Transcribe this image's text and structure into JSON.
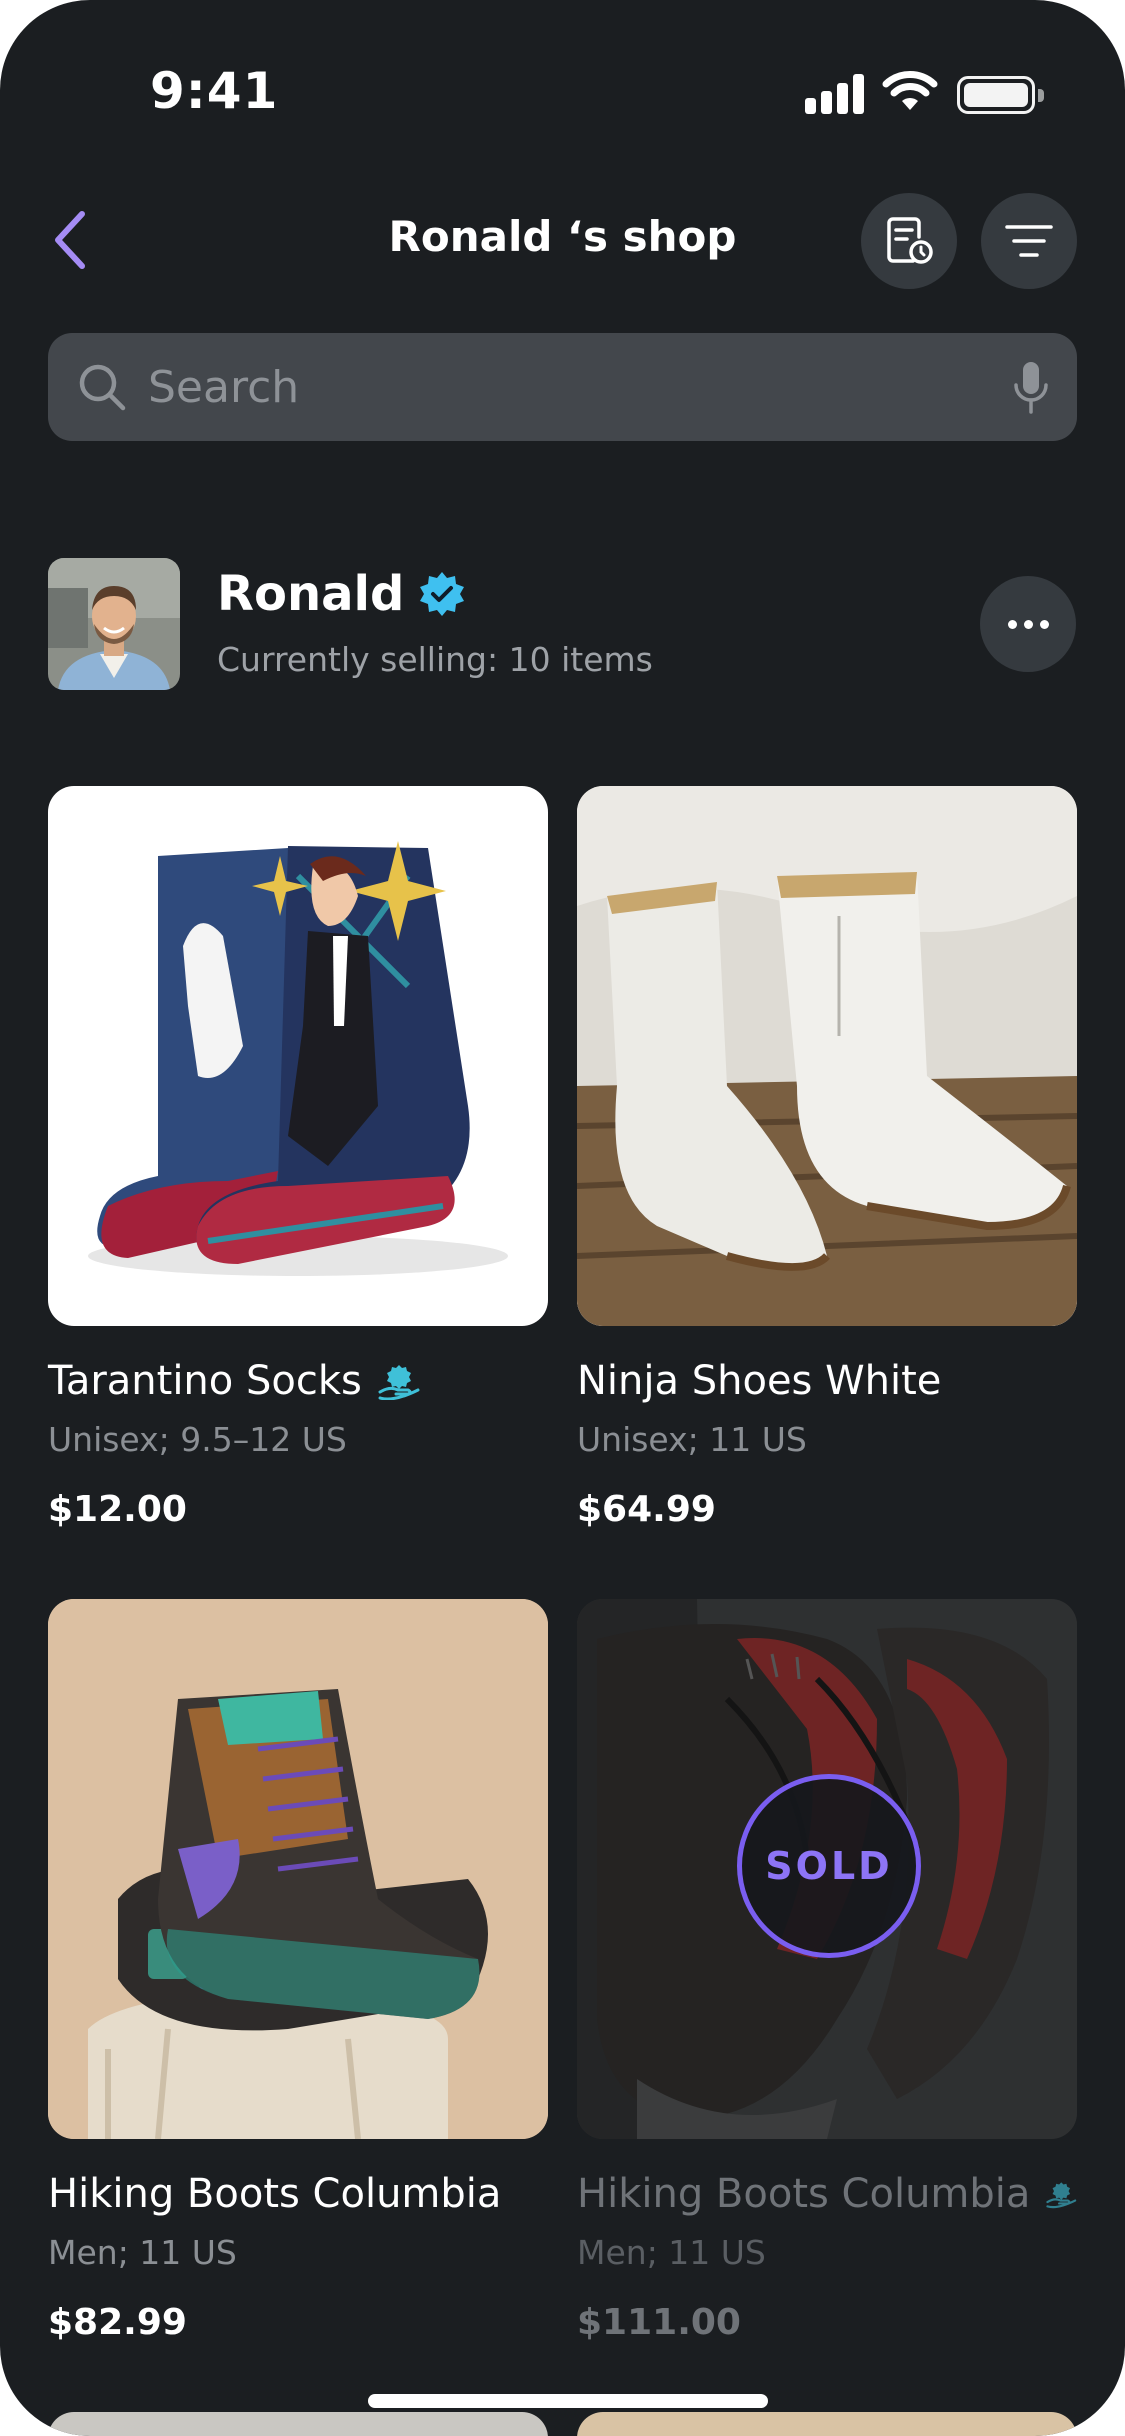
{
  "status_bar": {
    "time": "9:41"
  },
  "header": {
    "title": "Ronald ‘s shop"
  },
  "search": {
    "placeholder": "Search"
  },
  "profile": {
    "name": "Ronald",
    "subtitle": "Currently selling: 10 items"
  },
  "colors": {
    "background": "#1b1e21",
    "surface": "#353a3f",
    "accent": "#a58cf5",
    "verified": "#3fc0f0",
    "sold": "#7a5ef0"
  },
  "products": [
    {
      "title": "Tarantino Socks",
      "meta": "Unisex; 9.5–12 US",
      "price": "$12.00",
      "icon": "donation-icon",
      "sold": false
    },
    {
      "title": "Ninja Shoes White",
      "meta": "Unisex; 11 US",
      "price": "$64.99",
      "sold": false
    },
    {
      "title": "Hiking Boots Columbia",
      "meta": "Men; 11 US",
      "price": "$82.99",
      "sold": false
    },
    {
      "title": "Hiking Boots Columbia",
      "meta": "Men; 11 US",
      "price": "$111.00",
      "icon": "donation-icon",
      "sold": true,
      "badge": "SOLD"
    }
  ]
}
